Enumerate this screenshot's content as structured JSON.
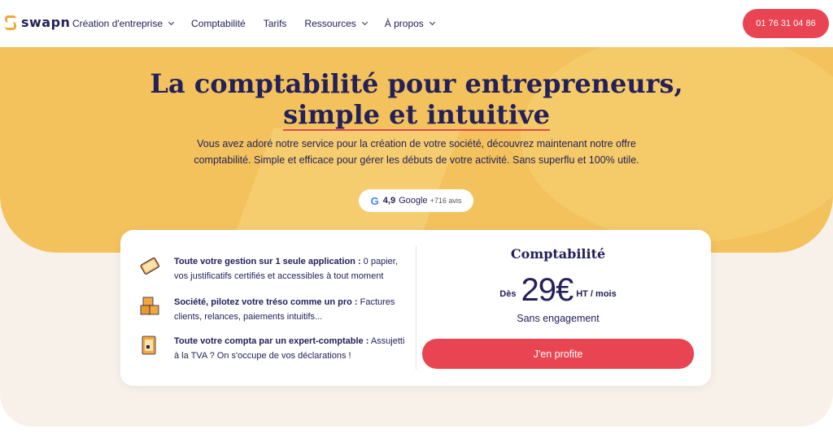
{
  "brand": {
    "name": "swapn"
  },
  "nav": {
    "items": [
      {
        "label": "Création d'entreprise",
        "has_dropdown": true
      },
      {
        "label": "Comptabilité",
        "has_dropdown": false
      },
      {
        "label": "Tarifs",
        "has_dropdown": false
      },
      {
        "label": "Ressources",
        "has_dropdown": true
      },
      {
        "label": "À propos",
        "has_dropdown": true
      }
    ],
    "phone": "01 76 31 04 86"
  },
  "hero": {
    "title_line1": "La comptabilité pour entrepreneurs,",
    "title_line2": "simple et intuitive",
    "subtitle_line1": "Vous avez adoré notre service pour la création de votre société, découvrez maintenant notre offre",
    "subtitle_line2": "comptabilité. Simple et efficace pour gérer les débuts de votre activité. Sans superflu et 100% utile.",
    "rating": {
      "icon": "google-icon",
      "score": "4,9",
      "source": "Google",
      "count": "+716 avis"
    }
  },
  "features": [
    {
      "icon": "tablet-icon",
      "bold": "Toute votre gestion sur 1 seule application :",
      "text": " 0 papier, vos justificatifs certifiés et accessibles à tout moment"
    },
    {
      "icon": "boxes-icon",
      "bold": "Société, pilotez votre tréso comme un pro :",
      "text": " Factures clients, relances, paiements intuitifs..."
    },
    {
      "icon": "document-icon",
      "bold": "Toute votre compta par un expert-comptable :",
      "text": " Assujetti à la TVA ? On s'occupe de vos déclarations !"
    }
  ],
  "offer": {
    "title": "Comptabilité",
    "price_prefix": "Dès",
    "price": "29€",
    "price_suffix": "HT / mois",
    "commitment": "Sans engagement",
    "cta": "J'en profite"
  },
  "colors": {
    "primary": "#23205a",
    "accent": "#e94452",
    "hero_bg": "#f3c25c",
    "cream": "#f8f1ea",
    "logo_orange": "#f0a83a"
  }
}
